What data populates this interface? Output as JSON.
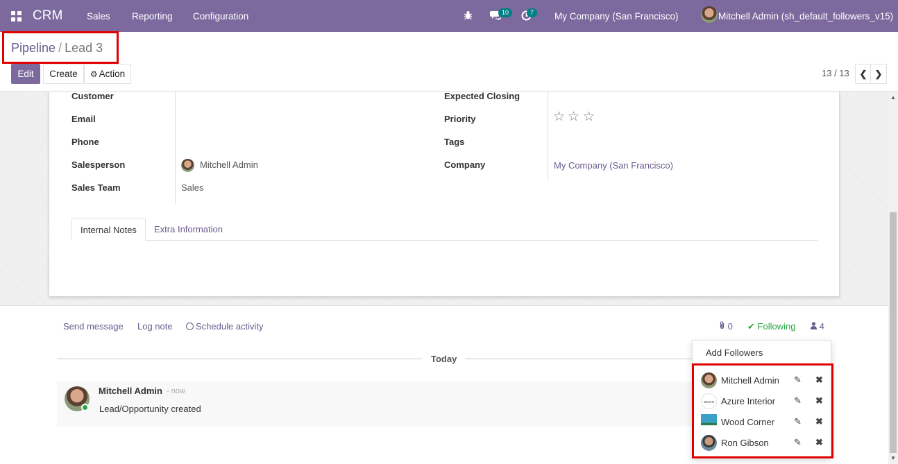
{
  "navbar": {
    "brand": "CRM",
    "menu": [
      "Sales",
      "Reporting",
      "Configuration"
    ],
    "messages_count": "10",
    "activities_count": "7",
    "company": "My Company (San Francisco)",
    "user": "Mitchell Admin (sh_default_followers_v15)",
    "icons": [
      "apps-grid-icon",
      "bug-icon",
      "chat-icon",
      "clock-icon"
    ]
  },
  "breadcrumb": {
    "parent": "Pipeline",
    "separator": "/",
    "current": "Lead 3"
  },
  "buttons": {
    "edit": "Edit",
    "create": "Create",
    "action": "Action",
    "action_icon": "⚙"
  },
  "pager": {
    "text": "13 / 13",
    "prev": "❮",
    "next": "❯"
  },
  "form": {
    "left_labels": [
      "Customer",
      "Email",
      "Phone",
      "Salesperson",
      "Sales Team"
    ],
    "salesperson": "Mitchell Admin",
    "sales_team": "Sales",
    "right_labels": [
      "Expected Closing",
      "Priority",
      "Tags",
      "Company"
    ],
    "company": "My Company (San Francisco)",
    "priority_stars": 0,
    "priority_max": 3,
    "tabs": [
      "Internal Notes",
      "Extra Information"
    ]
  },
  "chatter": {
    "send_message": "Send message",
    "log_note": "Log note",
    "schedule_activity": "Schedule activity",
    "attachments": "0",
    "following": "Following",
    "followers_count": "4",
    "today": "Today",
    "message": {
      "author": "Mitchell Admin",
      "time": "- now",
      "body": "Lead/Opportunity created"
    }
  },
  "followers_dropdown": {
    "add_followers": "Add Followers",
    "followers": [
      {
        "name": "Mitchell Admin",
        "avatar": "person-avatar"
      },
      {
        "name": "Azure Interior",
        "avatar": "azure-logo"
      },
      {
        "name": "Wood Corner",
        "avatar": "wood-corner-logo"
      },
      {
        "name": "Ron Gibson",
        "avatar": "person-avatar"
      }
    ],
    "edit_icon": "✎",
    "remove_icon": "✖"
  },
  "colors": {
    "brand": "#7c6a9e",
    "highlight": "#e10000",
    "following": "#28a745",
    "badge": "#017e84"
  }
}
